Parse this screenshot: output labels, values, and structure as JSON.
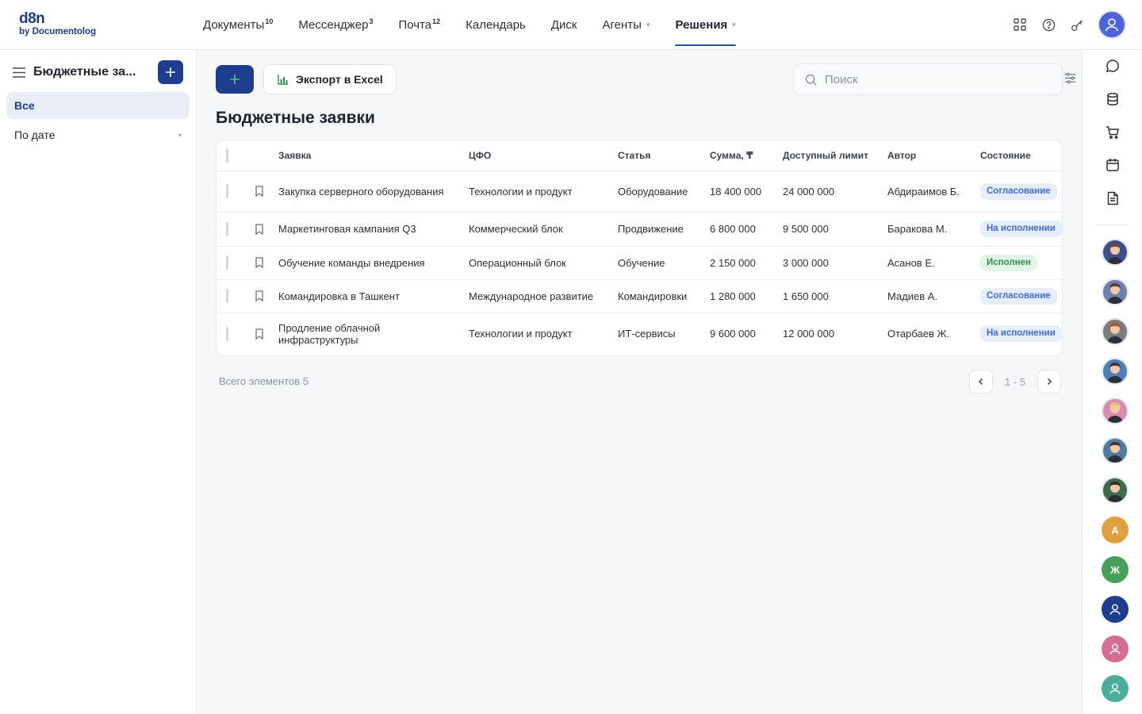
{
  "brand": {
    "logo_main": "d8n",
    "logo_sub": "by Documentolog"
  },
  "nav": [
    {
      "label": "Документы",
      "badge": "10"
    },
    {
      "label": "Мессенджер",
      "badge": "3"
    },
    {
      "label": "Почта",
      "badge": "12"
    },
    {
      "label": "Календарь"
    },
    {
      "label": "Диск"
    },
    {
      "label": "Агенты",
      "dot": "▾"
    },
    {
      "label": "Решения",
      "dot": "▾",
      "active": true
    }
  ],
  "sidebar": {
    "title": "Бюджетные за...",
    "items": [
      {
        "label": "Все",
        "active": true
      },
      {
        "label": "По дате",
        "caret": "▾"
      }
    ]
  },
  "toolbar": {
    "export_label": "Экспорт в Excel",
    "search_placeholder": "Поиск"
  },
  "page_title": "Бюджетные заявки",
  "table": {
    "columns": [
      "Заявка",
      "ЦФО",
      "Статья",
      "Сумма, ₸",
      "Доступный лимит",
      "Автор",
      "Состояние"
    ],
    "rows": [
      {
        "request": "Закупка серверного оборудования",
        "cfo": "Технологии и продукт",
        "item": "Оборудование",
        "sum": "18 400 000",
        "limit": "24 000 000",
        "author": "Абдираимов Б.",
        "status": "Согласование",
        "status_kind": "blue"
      },
      {
        "request": "Маркетинговая кампания Q3",
        "cfo": "Коммерческий блок",
        "item": "Продвижение",
        "sum": "6 800 000",
        "limit": "9 500 000",
        "author": "Баракова М.",
        "status": "На исполнении",
        "status_kind": "blue"
      },
      {
        "request": "Обучение команды внедрения",
        "cfo": "Операционный блок",
        "item": "Обучение",
        "sum": "2 150 000",
        "limit": "3 000 000",
        "author": "Асанов Е.",
        "status": "Исполнен",
        "status_kind": "green"
      },
      {
        "request": "Командировка в Ташкент",
        "cfo": "Международное развитие",
        "item": "Командировки",
        "sum": "1 280 000",
        "limit": "1 650 000",
        "author": "Мадиев А.",
        "status": "Согласование",
        "status_kind": "blue"
      },
      {
        "request": "Продление облачной инфраструктуры",
        "cfo": "Технологии и продукт",
        "item": "ИТ-сервисы",
        "sum": "9 600 000",
        "limit": "12 000 000",
        "author": "Отарбаев Ж.",
        "status": "На исполнении",
        "status_kind": "blue"
      }
    ]
  },
  "footer": {
    "total_label": "Всего элементов 5",
    "range": "1 - 5"
  },
  "rail": {
    "icons": [
      "chat-icon",
      "database-icon",
      "cart-icon",
      "calendar-icon",
      "document-icon"
    ],
    "avatars": [
      {
        "kind": "photo",
        "color": "#6b4a3a",
        "bg": "#3d4f8a"
      },
      {
        "kind": "photo",
        "color": "#5a3b2e",
        "bg": "#6c7fb0"
      },
      {
        "kind": "photo",
        "color": "#b5532d",
        "bg": "#7c7c7c"
      },
      {
        "kind": "photo",
        "color": "#3b3b3b",
        "bg": "#4c7fb9"
      },
      {
        "kind": "photo",
        "color": "#e4c27a",
        "bg": "#d98bb0"
      },
      {
        "kind": "photo",
        "color": "#4a3327",
        "bg": "#4f7ca3"
      },
      {
        "kind": "photo",
        "color": "#3a2a22",
        "bg": "#3d6b4d"
      },
      {
        "kind": "letter",
        "letter": "А",
        "bg": "#e0a040"
      },
      {
        "kind": "letter",
        "letter": "Ж",
        "bg": "#45a05a"
      },
      {
        "kind": "user",
        "bg": "#1e3d8f"
      },
      {
        "kind": "user",
        "bg": "#d46e93"
      },
      {
        "kind": "user",
        "bg": "#4aae9b"
      }
    ]
  },
  "colors": {
    "primary": "#1e3d8f",
    "accent_blue": "#3e6ad1",
    "success": "#2f9148"
  }
}
